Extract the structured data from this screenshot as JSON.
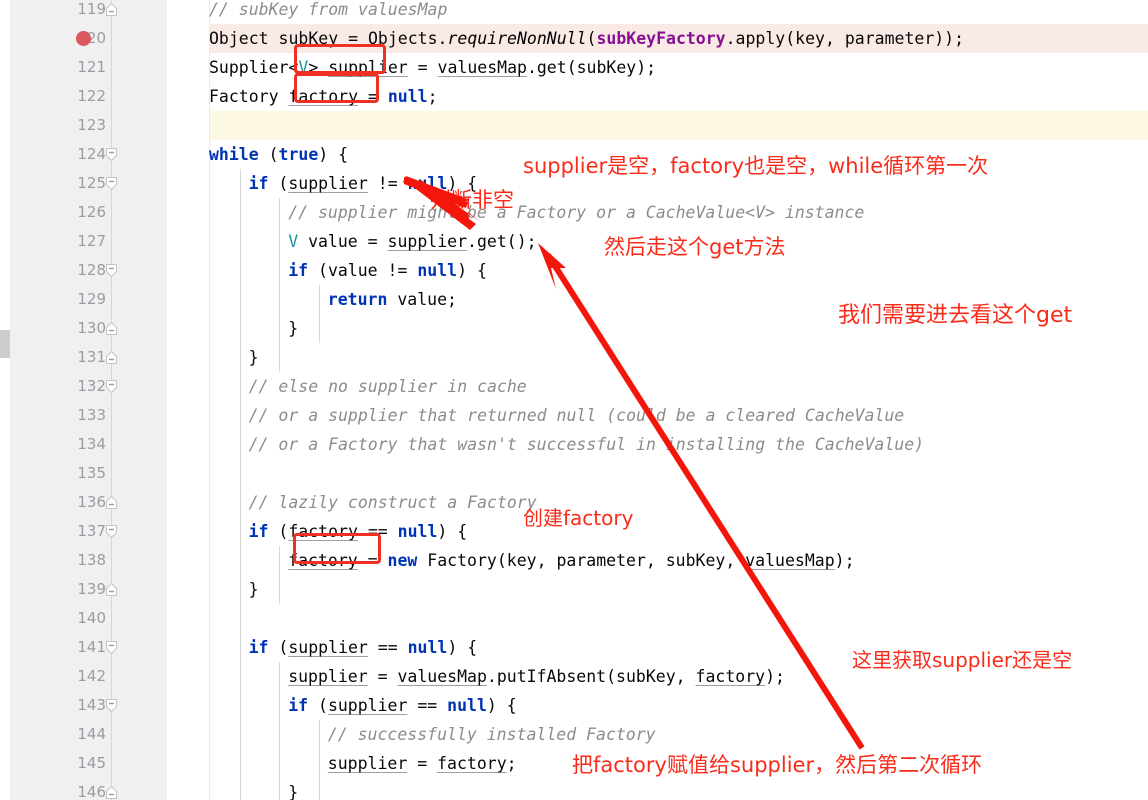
{
  "editor": {
    "language": "java",
    "colors": {
      "keyword": "#0033b3",
      "comment": "#8c8c8c",
      "type": "#20999d",
      "field": "#871094",
      "annotation_red": "#fb2b1a",
      "box_red": "#f03024",
      "breakpoint_red": "#db5860",
      "exec_line_bg": "#faeae6",
      "caret_line_bg": "#fdf8e3",
      "gutter_bg": "#f0f0f0"
    },
    "first_visible_line": 119,
    "last_visible_line": 146,
    "breakpoint_line": 120,
    "caret_line": 123,
    "execution_line": 120
  },
  "lines": [
    {
      "num": "119",
      "indent": 0,
      "fold": "end",
      "text": "// subKey from valuesMap"
    },
    {
      "num": "120",
      "indent": 0,
      "fold": "none",
      "text": "Object subKey = Objects.requireNonNull(subKeyFactory.apply(key, parameter));"
    },
    {
      "num": "121",
      "indent": 0,
      "fold": "none",
      "text": "Supplier<V> supplier = valuesMap.get(subKey);"
    },
    {
      "num": "122",
      "indent": 0,
      "fold": "none",
      "text": "Factory factory = null;"
    },
    {
      "num": "123",
      "indent": 0,
      "fold": "none",
      "text": ""
    },
    {
      "num": "124",
      "indent": 0,
      "fold": "start",
      "text": "while (true) {"
    },
    {
      "num": "125",
      "indent": 1,
      "fold": "start",
      "text": "if (supplier != null) {"
    },
    {
      "num": "126",
      "indent": 2,
      "fold": "none",
      "text": "// supplier might be a Factory or a CacheValue<V> instance"
    },
    {
      "num": "127",
      "indent": 2,
      "fold": "none",
      "text": "V value = supplier.get();"
    },
    {
      "num": "128",
      "indent": 2,
      "fold": "start",
      "text": "if (value != null) {"
    },
    {
      "num": "129",
      "indent": 3,
      "fold": "none",
      "text": "return value;"
    },
    {
      "num": "130",
      "indent": 2,
      "fold": "end",
      "text": "}"
    },
    {
      "num": "131",
      "indent": 1,
      "fold": "end",
      "text": "}"
    },
    {
      "num": "132",
      "indent": 1,
      "fold": "start",
      "text": "// else no supplier in cache"
    },
    {
      "num": "133",
      "indent": 1,
      "fold": "none",
      "text": "// or a supplier that returned null (could be a cleared CacheValue"
    },
    {
      "num": "134",
      "indent": 1,
      "fold": "none",
      "text": "// or a Factory that wasn't successful in installing the CacheValue)"
    },
    {
      "num": "135",
      "indent": 1,
      "fold": "none",
      "text": ""
    },
    {
      "num": "136",
      "indent": 1,
      "fold": "end",
      "text": "// lazily construct a Factory"
    },
    {
      "num": "137",
      "indent": 1,
      "fold": "start",
      "text": "if (factory == null) {"
    },
    {
      "num": "138",
      "indent": 2,
      "fold": "none",
      "text": "factory = new Factory(key, parameter, subKey, valuesMap);"
    },
    {
      "num": "139",
      "indent": 1,
      "fold": "end",
      "text": "}"
    },
    {
      "num": "140",
      "indent": 1,
      "fold": "none",
      "text": ""
    },
    {
      "num": "141",
      "indent": 1,
      "fold": "start",
      "text": "if (supplier == null) {"
    },
    {
      "num": "142",
      "indent": 2,
      "fold": "none",
      "text": "supplier = valuesMap.putIfAbsent(subKey, factory);"
    },
    {
      "num": "143",
      "indent": 2,
      "fold": "start",
      "text": "if (supplier == null) {"
    },
    {
      "num": "144",
      "indent": 3,
      "fold": "none",
      "text": "// successfully installed Factory"
    },
    {
      "num": "145",
      "indent": 3,
      "fold": "none",
      "text": "supplier = factory;"
    },
    {
      "num": "146",
      "indent": 2,
      "fold": "end",
      "text": "}"
    }
  ],
  "annotations": [
    {
      "id": "a1",
      "text": "supplier是空，factory也是空，while循环第一次",
      "size": 21
    },
    {
      "id": "a2",
      "text": "判断非空",
      "size": 21
    },
    {
      "id": "a3",
      "text": "然后走这个get方法",
      "size": 21
    },
    {
      "id": "a4",
      "text": "我们需要进去看这个get",
      "size": 22
    },
    {
      "id": "a5",
      "text": "创建factory",
      "size": 20
    },
    {
      "id": "a6",
      "text": "这里获取supplier还是空",
      "size": 20
    },
    {
      "id": "a7",
      "text": "把factory赋值给supplier，然后第二次循环",
      "size": 21
    }
  ],
  "highlight_boxes": [
    {
      "id": "box-supplier-121",
      "label": "supplier"
    },
    {
      "id": "box-factory-122",
      "label": "factory"
    },
    {
      "id": "box-factory-138",
      "label": "factory"
    }
  ],
  "arrows": [
    {
      "id": "arrow-not-null",
      "desc": "points to != null on line 125"
    },
    {
      "id": "arrow-supplier-get",
      "desc": "points to supplier on line 127"
    },
    {
      "id": "arrow-long-get",
      "desc": "long diagonal from line 145 up to supplier.get() on line 127"
    }
  ]
}
